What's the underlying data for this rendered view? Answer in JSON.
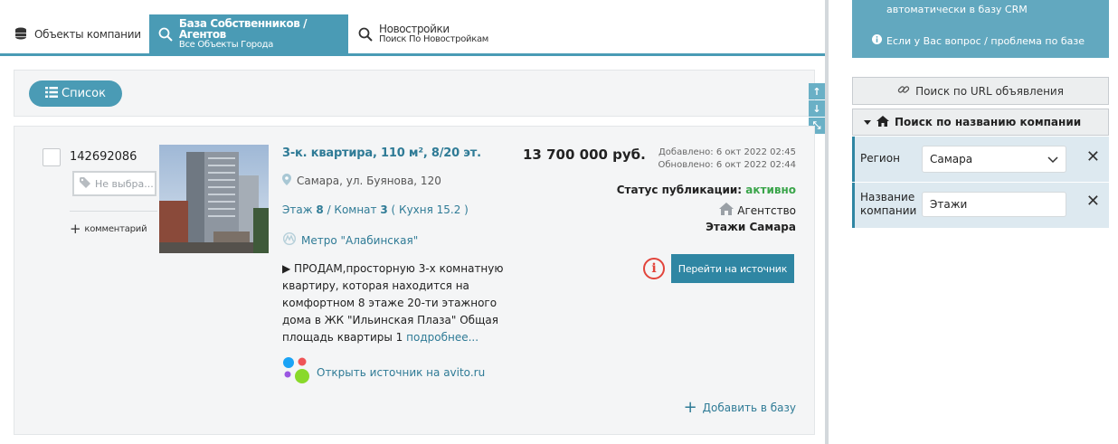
{
  "tabs": [
    {
      "title": "Объекты компании",
      "subtitle": ""
    },
    {
      "title": "База Собственников / Агентов",
      "subtitle": "Все Объекты Города"
    },
    {
      "title": "Новостройки",
      "subtitle": "Поиск По Новостройкам"
    }
  ],
  "toolbar": {
    "list_label": "Список"
  },
  "listing": {
    "id": "142692086",
    "tag_label": "Не выбра...",
    "comment_label": "комментарий",
    "title": "3-к. квартира, 110 м², 8/20 эт.",
    "address": "Самара, ул. Буянова, 120",
    "floor_prefix": "Этаж",
    "floor": "8",
    "rooms_prefix": "/ Комнат",
    "rooms": "3",
    "kitchen": "( Кухня 15.2 )",
    "metro": "Метро \"Алабинская\"",
    "description": "▶ ПРОДАМ,просторную 3-х комнатную квартиру, которая находится на комфортном 8 этаже 20-ти этажного дома в ЖК \"Ильинская Плаза\" Общая площадь квартиры 1",
    "more_label": "подробнее...",
    "source_label": "Открыть источник на avito.ru",
    "price": "13 700 000 руб.",
    "added": "Добавлено: 6 окт 2022  02:45",
    "updated": "Обновлено: 6 окт 2022  02:44",
    "status_label": "Статус публикации:",
    "status_value": "активно",
    "seller_type": "Агентство",
    "company": "Этажи Самара",
    "goto_label": "Перейти на источник",
    "add_label": "Добавить в базу"
  },
  "right_panel": {
    "crm_line": "автоматически в базу CRM",
    "help_line": "Если у Вас вопрос / проблема по базе",
    "url_search_label": "Поиск по URL объявления",
    "company_search_label": "Поиск по названию компании",
    "region_label": "Регион",
    "region_value": "Самара",
    "company_label_1": "Название",
    "company_label_2": "компании",
    "company_value": "Этажи"
  },
  "colors": {
    "accent": "#4a9bb5",
    "status_ok": "#3aa54a",
    "alert": "#e2443b"
  }
}
